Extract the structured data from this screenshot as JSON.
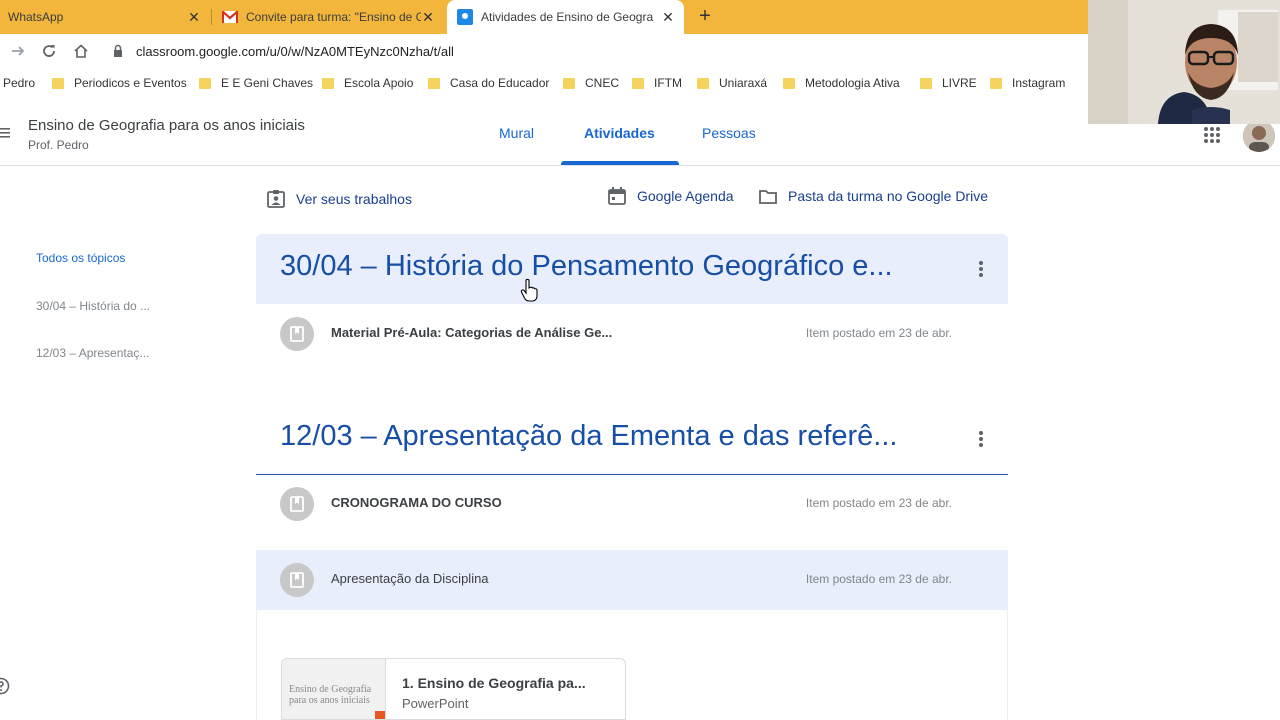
{
  "browser": {
    "tabs": [
      {
        "title": "WhatsApp",
        "close": "✕"
      },
      {
        "title": "Convite para turma: \"Ensino de G",
        "close": "✕"
      },
      {
        "title": "Atividades de Ensino de Geografi",
        "close": "✕"
      }
    ],
    "new_tab": "+",
    "url": "classroom.google.com/u/0/w/NzA0MTEyNzc0Nzha/t/all",
    "bookmarks": [
      "Pedro",
      "Periodicos e Eventos",
      "E E Geni Chaves",
      "Escola Apoio",
      "Casa do Educador",
      "CNEC",
      "IFTM",
      "Uniaraxá",
      "Metodologia Ativa",
      "LIVRE",
      "Instagram"
    ]
  },
  "header": {
    "class_title": "Ensino de Geografia para os anos iniciais",
    "class_subtitle": "Prof. Pedro",
    "tabs": [
      {
        "label": "Mural"
      },
      {
        "label": "Atividades"
      },
      {
        "label": "Pessoas"
      }
    ]
  },
  "actions": {
    "view_work": "Ver seus trabalhos",
    "calendar": "Google Agenda",
    "drive_folder": "Pasta da turma no Google Drive"
  },
  "sidebar": {
    "items": [
      {
        "label": "Todos os tópicos"
      },
      {
        "label": "30/04 – História do ..."
      },
      {
        "label": "12/03 – Apresentaç..."
      }
    ]
  },
  "topics": [
    {
      "title": "30/04 – História do Pensamento Geográfico e...",
      "items": [
        {
          "title": "Material Pré-Aula: Categorias de Análise Ge...",
          "date": "Item postado em 23 de abr."
        }
      ]
    },
    {
      "title": "12/03 – Apresentação da Ementa e das referê...",
      "items": [
        {
          "title": "CRONOGRAMA DO CURSO",
          "date": "Item postado em 23 de abr."
        },
        {
          "title": "Apresentação da Disciplina",
          "date": "Item postado em 23 de abr."
        }
      ]
    }
  ],
  "attachment": {
    "title": "1. Ensino de Geografia pa...",
    "type": "PowerPoint",
    "thumb_text": "Ensino de Geografia para os anos iniciais"
  },
  "colors": {
    "tab_bar": "#f2b63d",
    "accent": "#1967d2",
    "topic_title": "#174ea6",
    "highlight": "#e8eefb"
  }
}
